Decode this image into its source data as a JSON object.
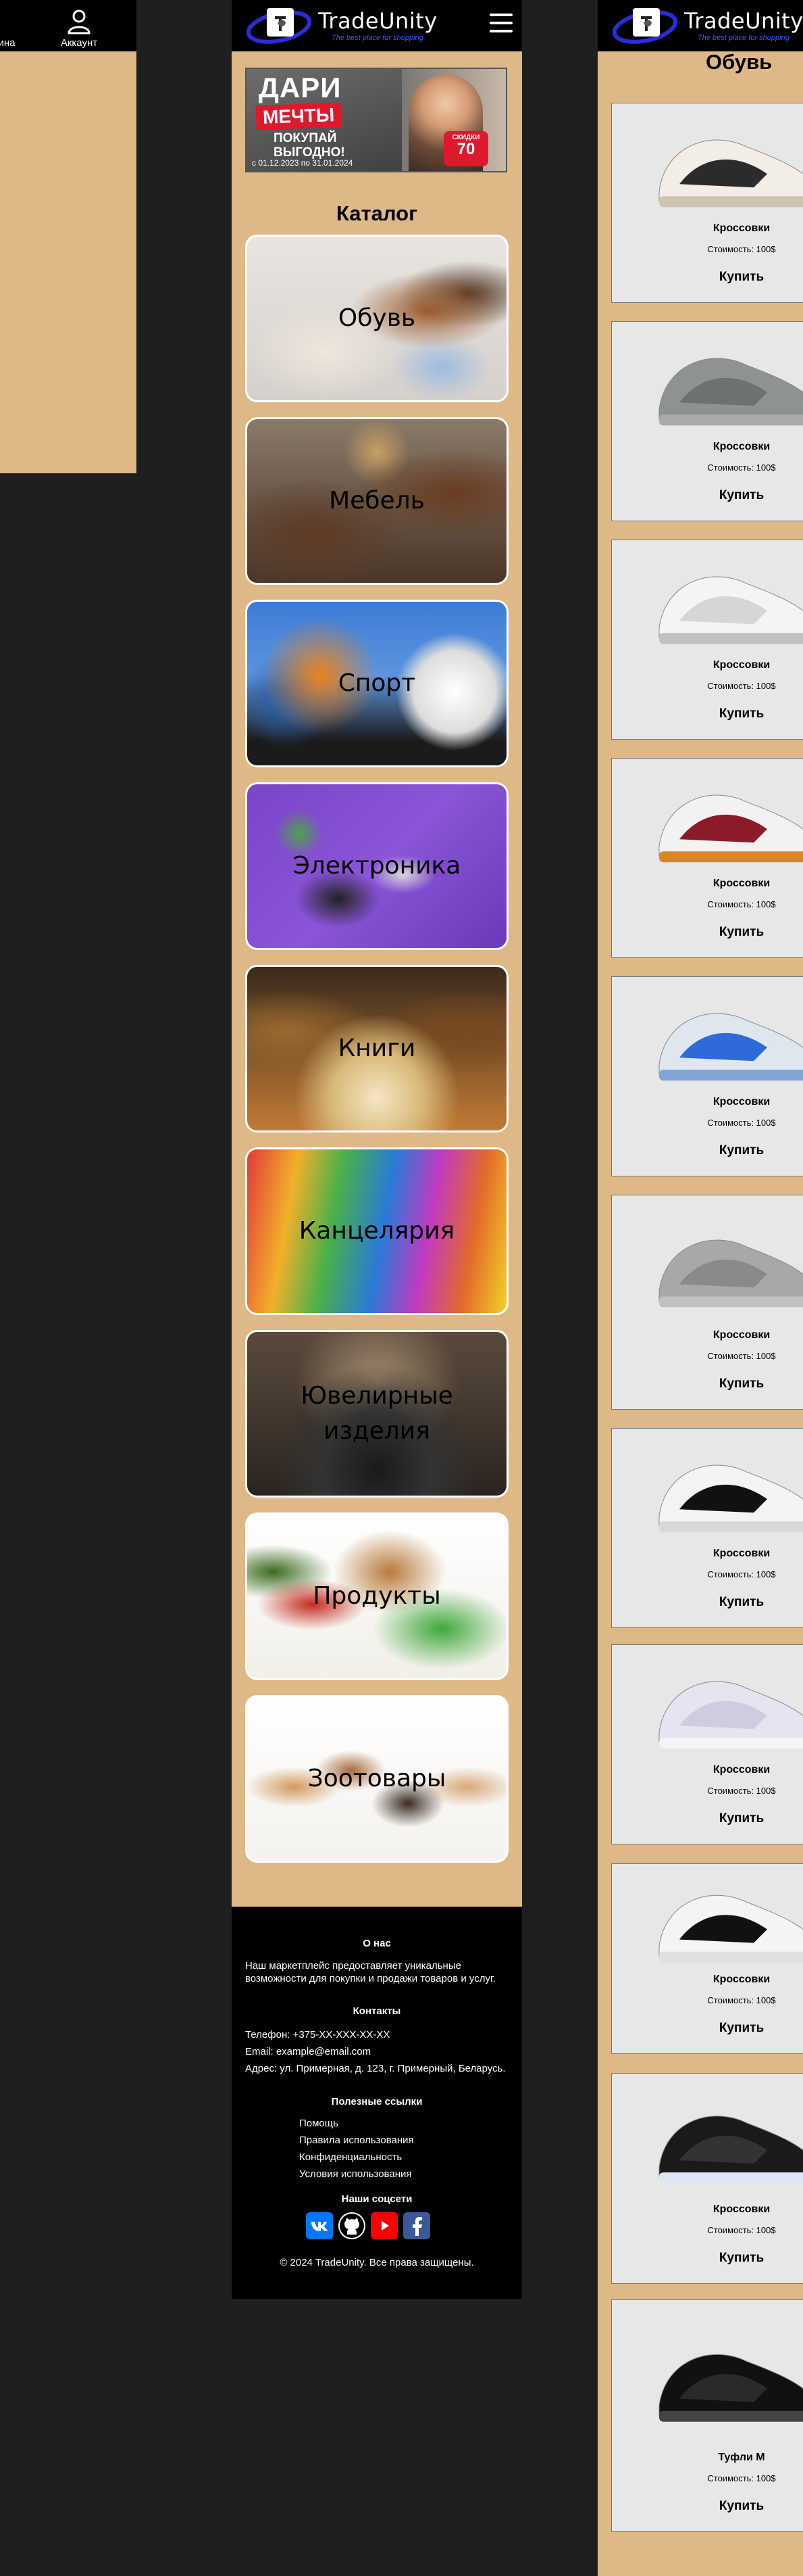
{
  "left_screen": {
    "nav_partial_label": "ина",
    "account_label": "Аккаунт"
  },
  "brand": {
    "name": "TradeUnity",
    "slogan": "The best place for shopping"
  },
  "banner": {
    "line1": "ДАРИ",
    "line2": "МЕЧТЫ",
    "line3": "ПОКУПАЙ",
    "line4": "ВЫГОДНО!",
    "dates": "с 01.12.2023 по 31.01.2024",
    "badge_top": "СКИДКИ",
    "badge_value": "70"
  },
  "catalog": {
    "title": "Каталог",
    "categories": [
      {
        "label": "Обувь"
      },
      {
        "label": "Мебель"
      },
      {
        "label": "Спорт"
      },
      {
        "label": "Электроника"
      },
      {
        "label": "Книги"
      },
      {
        "label": "Канцелярия"
      },
      {
        "label": "Ювелирные изделия"
      },
      {
        "label": "Продукты"
      },
      {
        "label": "Зоотовары"
      }
    ]
  },
  "footer": {
    "about_title": "О нас",
    "about_text": "Наш маркетплейс предоставляет уникальные возможности для покупки и продажи товаров и услуг.",
    "contacts_title": "Контакты",
    "phone": "Телефон: +375-XX-XXX-XX-XX",
    "email": "Email: example@email.com",
    "address": "Адрес: ул. Примерная, д. 123, г. Примерный, Беларусь.",
    "links_title": "Полезные ссылки",
    "links": [
      "Помощь",
      "Правила использования",
      "Конфиденциальность",
      "Условия использования"
    ],
    "social_title": "Наши соцсети",
    "social": [
      {
        "icon": "vk-icon",
        "color": "#0077ff"
      },
      {
        "icon": "github-icon",
        "color": "#000000"
      },
      {
        "icon": "youtube-icon",
        "color": "#ff0000"
      },
      {
        "icon": "facebook-icon",
        "color": "#3b5998"
      }
    ],
    "copyright": "© 2024 TradeUnity. Все права защищены."
  },
  "products_page": {
    "title": "Обувь",
    "buy_label": "Купить",
    "products": [
      {
        "name": "Кроссовки",
        "price": "Стоимость: 100$",
        "image": "sneaker-beige-icon"
      },
      {
        "name": "Кроссовки",
        "price": "Стоимость: 100$",
        "image": "sneaker-grey-icon"
      },
      {
        "name": "Кроссовки",
        "price": "Стоимость: 100$",
        "image": "sneaker-white-icon"
      },
      {
        "name": "Кроссовки",
        "price": "Стоимость: 100$",
        "image": "sneaker-red-white-icon"
      },
      {
        "name": "Кроссовки",
        "price": "Стоимость: 100$",
        "image": "sneaker-blue-icon"
      },
      {
        "name": "Кроссовки",
        "price": "Стоимость: 100$",
        "image": "sneaker-grey-runner-icon"
      },
      {
        "name": "Кроссовки",
        "price": "Стоимость: 100$",
        "image": "sneaker-black-white-icon"
      },
      {
        "name": "Кроссовки",
        "price": "Стоимость: 100$",
        "image": "sneaker-lilac-icon"
      },
      {
        "name": "Кроссовки",
        "price": "Стоимость: 100$",
        "image": "sneaker-panda-icon"
      },
      {
        "name": "Кроссовки",
        "price": "Стоимость: 100$",
        "image": "sneaker-black-icon"
      },
      {
        "name": "Туфли М",
        "price": "Стоимость: 100$",
        "image": "dress-shoe-black-icon"
      }
    ]
  }
}
